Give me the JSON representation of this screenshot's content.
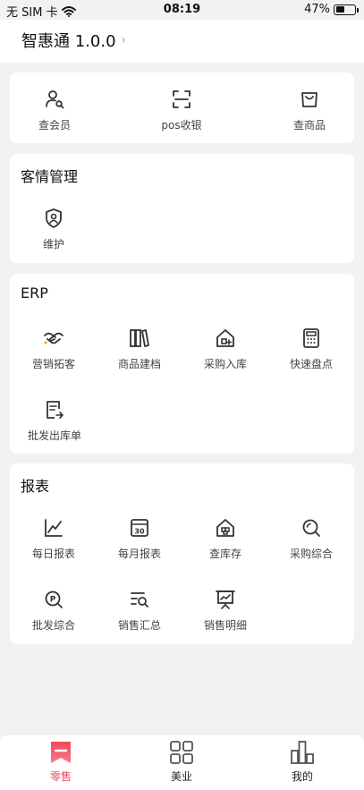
{
  "status_bar": {
    "carrier": "无 SIM 卡",
    "time": "08:19",
    "battery": "47%",
    "battery_level": 0.47
  },
  "header": {
    "title": "智惠通 1.0.0"
  },
  "quick": {
    "items": [
      {
        "label": "查会员",
        "icon": "member-search-icon"
      },
      {
        "label": "pos收银",
        "icon": "scan-icon"
      },
      {
        "label": "查商品",
        "icon": "bag-icon"
      }
    ]
  },
  "crm": {
    "title": "客情管理",
    "items": [
      {
        "label": "维护",
        "icon": "shield-user-icon"
      }
    ]
  },
  "erp": {
    "title": "ERP",
    "items": [
      {
        "label": "营销拓客",
        "icon": "handshake-icon"
      },
      {
        "label": "商品建档",
        "icon": "books-icon"
      },
      {
        "label": "采购入库",
        "icon": "warehouse-in-icon"
      },
      {
        "label": "快速盘点",
        "icon": "calculator-icon"
      },
      {
        "label": "批发出库单",
        "icon": "document-out-icon"
      }
    ]
  },
  "reports": {
    "title": "报表",
    "items": [
      {
        "label": "每日报表",
        "icon": "line-chart-icon"
      },
      {
        "label": "每月报表",
        "icon": "calendar-icon"
      },
      {
        "label": "查库存",
        "icon": "inventory-icon"
      },
      {
        "label": "采购综合",
        "icon": "search-icon"
      },
      {
        "label": "批发综合",
        "icon": "p-search-icon"
      },
      {
        "label": "销售汇总",
        "icon": "list-search-icon"
      },
      {
        "label": "销售明细",
        "icon": "presentation-icon"
      }
    ]
  },
  "tabs": [
    {
      "label": "零售",
      "icon": "bookmark-icon",
      "active": true
    },
    {
      "label": "美业",
      "icon": "grid-icon",
      "active": false
    },
    {
      "label": "我的",
      "icon": "bar-chart-icon",
      "active": false
    }
  ],
  "colors": {
    "accent": "#f0485e",
    "icon": "#333333",
    "background": "#f2f2f2"
  }
}
